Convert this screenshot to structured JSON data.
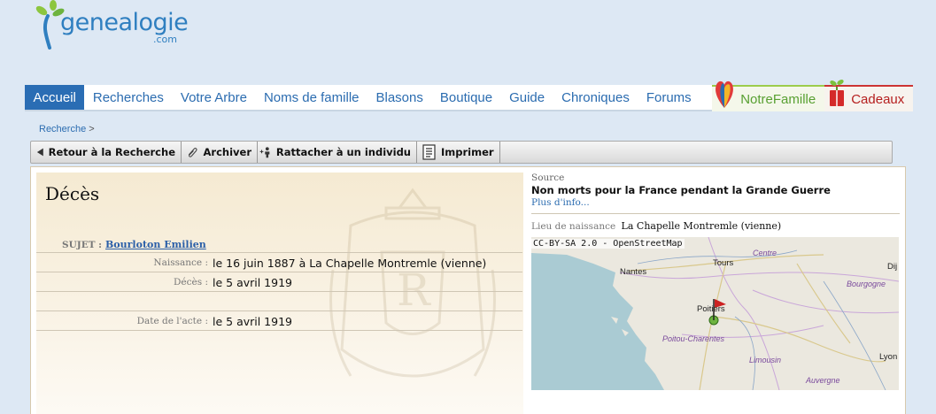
{
  "logo": {
    "name": "genealogie",
    "suffix": ".com"
  },
  "nav": {
    "items": [
      {
        "label": "Accueil",
        "active": true
      },
      {
        "label": "Recherches"
      },
      {
        "label": "Votre Arbre"
      },
      {
        "label": "Noms de famille"
      },
      {
        "label": "Blasons"
      },
      {
        "label": "Boutique"
      },
      {
        "label": "Guide"
      },
      {
        "label": "Chroniques"
      },
      {
        "label": "Forums"
      }
    ],
    "notrefamille": "NotreFamille",
    "cadeaux": "Cadeaux"
  },
  "breadcrumb": {
    "link": "Recherche",
    "sep": ">"
  },
  "toolbar": {
    "retour": "Retour à la Recherche",
    "archiver": "Archiver",
    "rattacher": "Rattacher à un individu",
    "imprimer": "Imprimer"
  },
  "record": {
    "title": "Décès",
    "subject_label": "SUJET :",
    "subject_value": "Bourloton Emilien",
    "naissance_label": "Naissance :",
    "naissance_value": "le 16 juin 1887 à La Chapelle Montremle (vienne)",
    "deces_label": "Décès :",
    "deces_value": "le 5 avril 1919",
    "acte_label": "Date de l'acte :",
    "acte_value": "le 5 avril 1919"
  },
  "source": {
    "label": "Source",
    "value": "Non morts pour la France pendant la Grande Guerre",
    "more": "Plus d'info..."
  },
  "birthplace": {
    "label": "Lieu de naissance",
    "value": "La Chapelle Montremle (vienne)"
  },
  "map": {
    "attribution": "CC-BY-SA 2.0 - OpenStreetMap",
    "cities": [
      "Nantes",
      "Tours",
      "Poitiers",
      "Lyon",
      "Dij"
    ],
    "regions": [
      "Centre",
      "Bourgogne",
      "Poitou-Charentes",
      "Limousin",
      "Auvergne"
    ],
    "colors": {
      "sea": "#aacbd3",
      "land": "#ebe8df",
      "marker": "#cc2222"
    }
  }
}
